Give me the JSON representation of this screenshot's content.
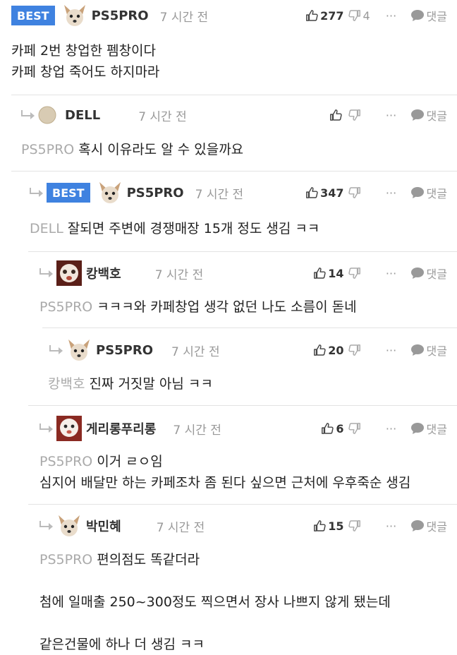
{
  "comments": [
    {
      "author": "PS5PRO",
      "time": "7 시간 전",
      "best_label": "BEST",
      "likes": "277",
      "dislikes": "4",
      "more": "···",
      "reply_label": "댓글",
      "lines": [
        "카페 2번 창업한 펨창이다",
        "카페 창업 죽어도 하지마라"
      ]
    },
    {
      "author": "DELL",
      "time": "7 시간 전",
      "likes": "",
      "dislikes": "",
      "more": "···",
      "reply_label": "댓글",
      "mention": "PS5PRO",
      "lines": [
        "혹시 이유라도 알 수 있을까요"
      ]
    },
    {
      "author": "PS5PRO",
      "time": "7 시간 전",
      "best_label": "BEST",
      "likes": "347",
      "dislikes": "",
      "more": "···",
      "reply_label": "댓글",
      "mention": "DELL",
      "lines": [
        "잘되면 주변에 경쟁매장 15개 정도 생김 ㅋㅋ"
      ]
    },
    {
      "author": "캉백호",
      "time": "7 시간 전",
      "likes": "14",
      "dislikes": "",
      "more": "···",
      "reply_label": "댓글",
      "mention": "PS5PRO",
      "lines": [
        "ㅋㅋㅋ와 카페창업 생각 없던 나도 소름이 돋네"
      ]
    },
    {
      "author": "PS5PRO",
      "time": "7 시간 전",
      "likes": "20",
      "dislikes": "",
      "more": "···",
      "reply_label": "댓글",
      "mention": "캉백호",
      "lines": [
        "진짜 거짓말 아님 ㅋㅋ"
      ]
    },
    {
      "author": "게리롱푸리롱",
      "time": "7 시간 전",
      "likes": "6",
      "dislikes": "",
      "more": "···",
      "reply_label": "댓글",
      "mention": "PS5PRO",
      "lines": [
        "이거 ㄹㅇ임",
        "심지어 배달만 하는 카페조차 좀 된다 싶으면 근처에 우후죽순 생김"
      ]
    },
    {
      "author": "박민혜",
      "time": "7 시간 전",
      "likes": "15",
      "dislikes": "",
      "more": "···",
      "reply_label": "댓글",
      "mention": "PS5PRO",
      "lines": [
        "편의점도 똑같더라",
        "",
        "첨에 일매출 250~300정도 찍으면서 장사 나쁘지 않게 됐는데",
        "",
        "같은건물에 하나 더 생김 ㅋㅋ"
      ]
    }
  ],
  "colors": {
    "best_badge": "#3f82e0",
    "meta_gray": "#999999",
    "divider": "#e3e3e3"
  },
  "icons": [
    "thumbs-up-icon",
    "thumbs-down-icon",
    "more-icon",
    "reply-bubble-icon",
    "reply-arrow-icon"
  ]
}
